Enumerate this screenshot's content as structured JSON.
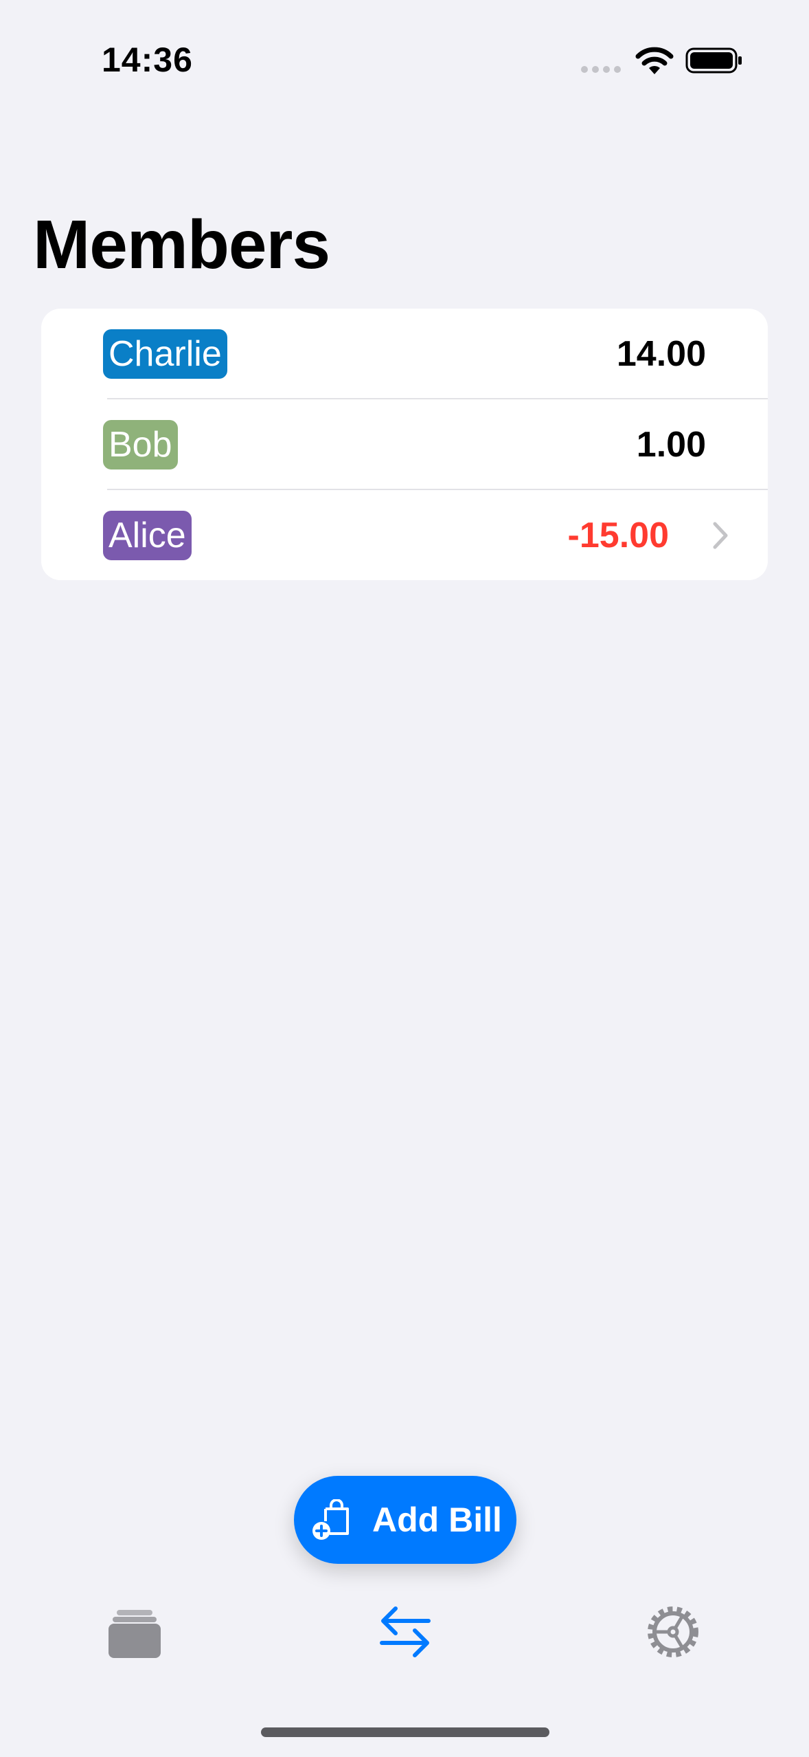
{
  "status_bar": {
    "time": "14:36"
  },
  "page": {
    "title": "Members"
  },
  "members": [
    {
      "name": "Charlie",
      "amount": "14.00",
      "chip_color": "#0a7fc7",
      "negative": false
    },
    {
      "name": "Bob",
      "amount": "1.00",
      "chip_color": "#8fb27a",
      "negative": false
    },
    {
      "name": "Alice",
      "amount": "-15.00",
      "chip_color": "#7b5aae",
      "negative": true
    }
  ],
  "add_bill": {
    "label": "Add Bill",
    "icon": "bag-plus-icon"
  },
  "tabs": [
    {
      "icon": "stack-icon",
      "active": false
    },
    {
      "icon": "arrows-left-right-icon",
      "active": true
    },
    {
      "icon": "gear-icon",
      "active": false
    }
  ],
  "colors": {
    "accent": "#007aff",
    "negative": "#ff3b30",
    "inactive_tab": "#8e8e93",
    "background": "#f2f2f7"
  }
}
